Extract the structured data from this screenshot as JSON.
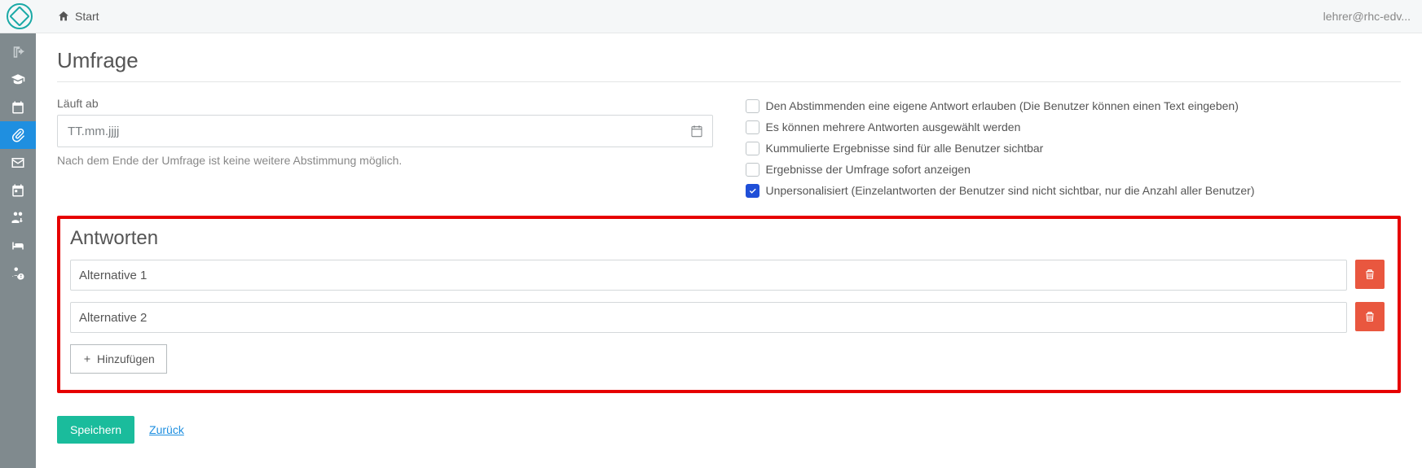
{
  "header": {
    "start": "Start",
    "user": "lehrer@rhc-edv..."
  },
  "page": {
    "title": "Umfrage",
    "expires_label": "Läuft ab",
    "date_placeholder": "TT.mm.jjjj",
    "expires_hint": "Nach dem Ende der Umfrage ist keine weitere Abstimmung möglich."
  },
  "options": [
    {
      "label": "Den Abstimmenden eine eigene Antwort erlauben (Die Benutzer können einen Text eingeben)",
      "checked": false
    },
    {
      "label": "Es können mehrere Antworten ausgewählt werden",
      "checked": false
    },
    {
      "label": "Kummulierte Ergebnisse sind für alle Benutzer sichtbar",
      "checked": false
    },
    {
      "label": "Ergebnisse der Umfrage sofort anzeigen",
      "checked": false
    },
    {
      "label": "Unpersonalisiert (Einzelantworten der Benutzer sind nicht sichtbar, nur die Anzahl aller Benutzer)",
      "checked": true
    }
  ],
  "answers": {
    "title": "Antworten",
    "items": [
      "Alternative 1",
      "Alternative 2"
    ],
    "add_label": "Hinzufügen"
  },
  "actions": {
    "save": "Speichern",
    "back": "Zurück"
  }
}
